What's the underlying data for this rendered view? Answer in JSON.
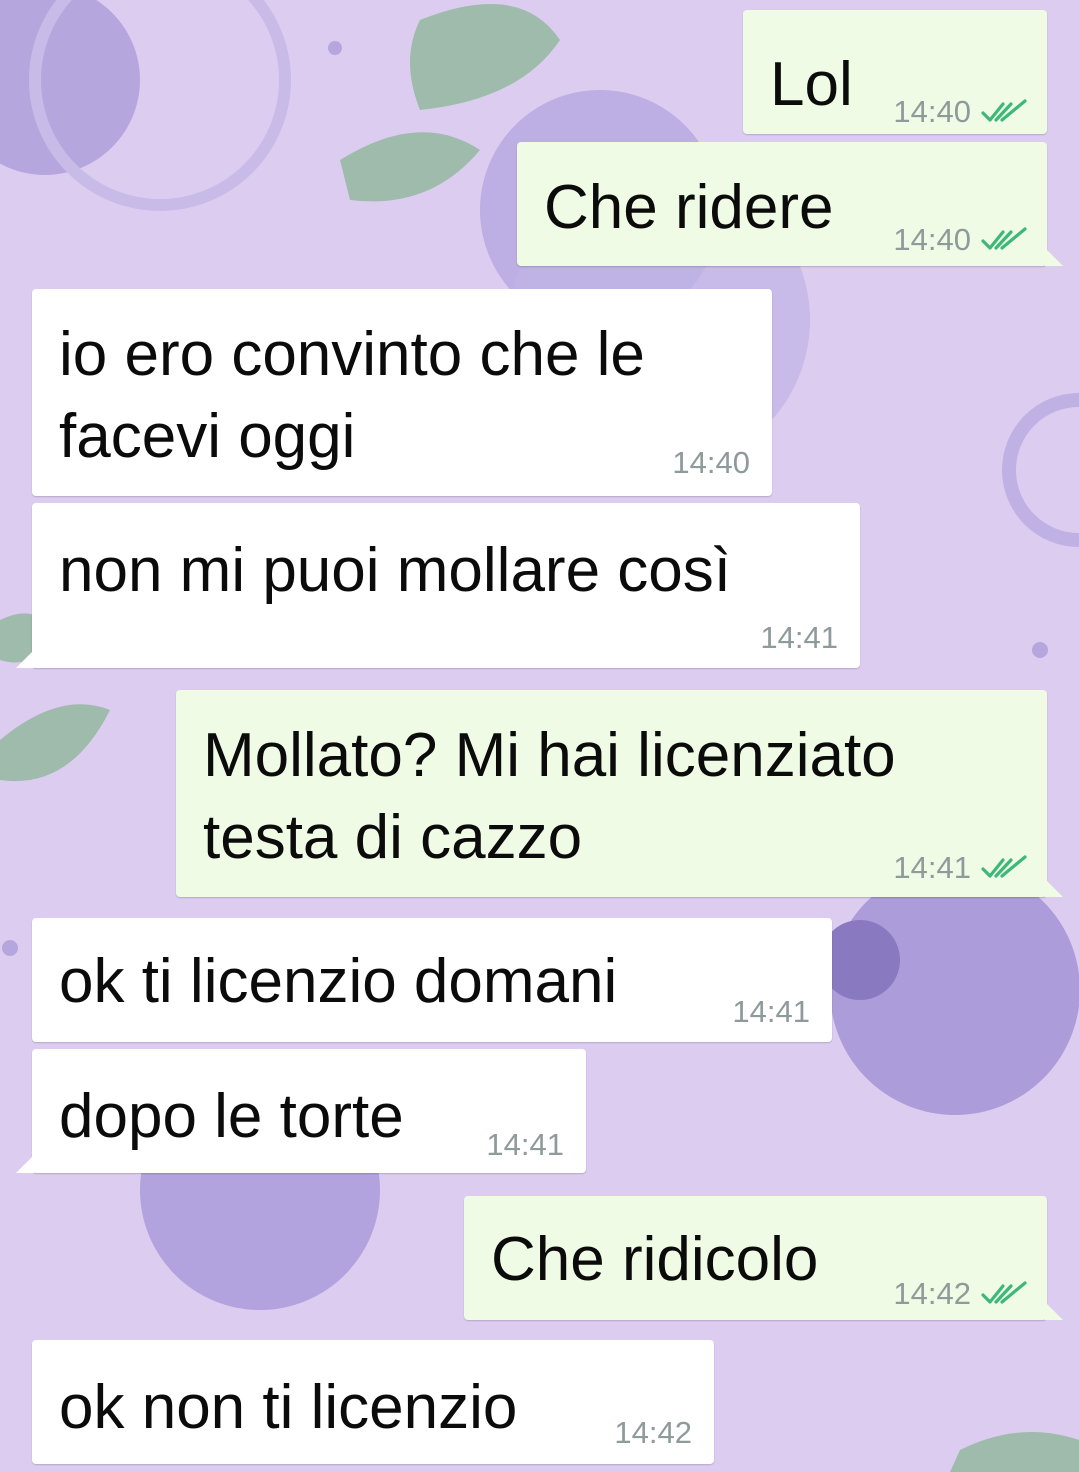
{
  "chat": {
    "messages": [
      {
        "direction": "out",
        "text_lines": [
          "Lol"
        ],
        "time": "14:40",
        "status_icon": "double-check-icon"
      },
      {
        "direction": "out",
        "text_lines": [
          "Che ridere"
        ],
        "time": "14:40",
        "status_icon": "double-check-icon"
      },
      {
        "direction": "in",
        "text_lines": [
          "io ero convinto che le",
          "facevi oggi"
        ],
        "time": "14:40"
      },
      {
        "direction": "in",
        "text_lines": [
          "non mi puoi mollare così"
        ],
        "time": "14:41"
      },
      {
        "direction": "out",
        "text_lines": [
          "Mollato? Mi hai licenziato",
          "testa di cazzo"
        ],
        "time": "14:41",
        "status_icon": "double-check-icon"
      },
      {
        "direction": "in",
        "text_lines": [
          "ok ti licenzio domani"
        ],
        "time": "14:41"
      },
      {
        "direction": "in",
        "text_lines": [
          "dopo le torte"
        ],
        "time": "14:41"
      },
      {
        "direction": "out",
        "text_lines": [
          "Che ridicolo"
        ],
        "time": "14:42",
        "status_icon": "double-check-icon"
      },
      {
        "direction": "in",
        "text_lines": [
          "ok non ti licenzio"
        ],
        "time": "14:42"
      }
    ]
  },
  "colors": {
    "wallpaper": "#dccdf0",
    "incoming_bubble": "#ffffff",
    "outgoing_bubble": "#effbe4",
    "timestamp": "#8f9a9a",
    "read_check": "#3db87a"
  }
}
